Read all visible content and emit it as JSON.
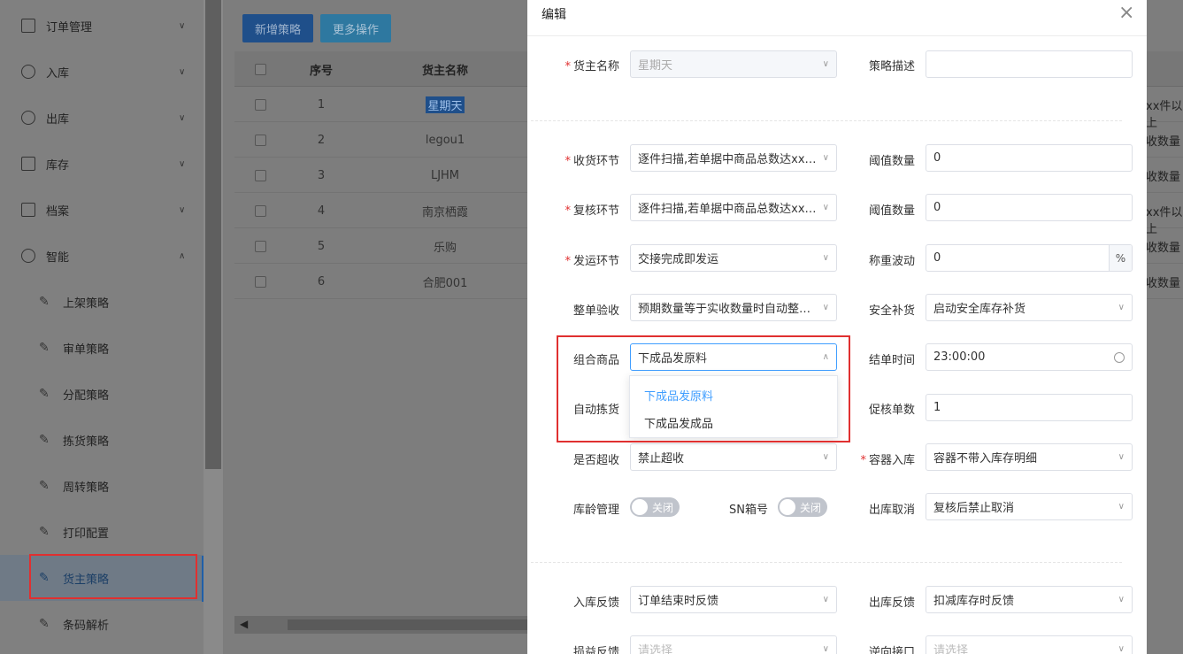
{
  "sidebar": {
    "menus": [
      {
        "label": "订单管理",
        "icon": "order-icon",
        "state": "collapsed"
      },
      {
        "label": "入库",
        "icon": "inbound-icon",
        "state": "collapsed"
      },
      {
        "label": "出库",
        "icon": "outbound-icon",
        "state": "collapsed"
      },
      {
        "label": "库存",
        "icon": "inventory-icon",
        "state": "collapsed"
      },
      {
        "label": "档案",
        "icon": "archive-icon",
        "state": "collapsed"
      },
      {
        "label": "智能",
        "icon": "smart-icon",
        "state": "expanded"
      }
    ],
    "sub_items": [
      "上架策略",
      "审单策略",
      "分配策略",
      "拣货策略",
      "周转策略",
      "打印配置",
      "货主策略",
      "条码解析"
    ],
    "active_sub": "货主策略"
  },
  "toolbar": {
    "add_label": "新增策略",
    "more_label": "更多操作"
  },
  "table": {
    "headers": {
      "index": "序号",
      "owner": "货主名称"
    },
    "rows": [
      {
        "index": "1",
        "owner": "星期天",
        "peek": "xx件以上"
      },
      {
        "index": "2",
        "owner": "legou1",
        "peek": "收数量"
      },
      {
        "index": "3",
        "owner": "LJHM",
        "peek": "收数量"
      },
      {
        "index": "4",
        "owner": "南京栖霞",
        "peek": "xx件以上"
      },
      {
        "index": "5",
        "owner": "乐购",
        "peek": "收数量"
      },
      {
        "index": "6",
        "owner": "合肥001",
        "peek": "收数量"
      }
    ]
  },
  "drawer": {
    "title": "编辑",
    "owner_label": "货主名称",
    "owner_value": "星期天",
    "desc_label": "策略描述",
    "desc_value": "",
    "receive_label": "收货环节",
    "receive_value": "逐件扫描,若单据中商品总数达xxx件以上",
    "threshold1_label": "阈值数量",
    "threshold1_value": "0",
    "review_label": "复核环节",
    "review_value": "逐件扫描,若单据中商品总数达xxx件以上",
    "threshold2_label": "阈值数量",
    "threshold2_value": "0",
    "ship_label": "发运环节",
    "ship_value": "交接完成即发运",
    "weight_label": "称重波动",
    "weight_value": "0",
    "weight_unit": "%",
    "check_label": "整单验收",
    "check_value": "预期数量等于实收数量时自动整单验收",
    "safety_label": "安全补货",
    "safety_value": "启动安全库存补货",
    "combo_label": "组合商品",
    "combo_value": "下成品发原料",
    "close_time_label": "结单时间",
    "close_time_value": "23:00:00",
    "autopick_label": "自动拣货",
    "urge_label": "促核单数",
    "urge_value": "1",
    "over_label": "是否超收",
    "over_value": "禁止超收",
    "container_label": "容器入库",
    "container_value": "容器不带入库存明细",
    "age_label": "库龄管理",
    "age_toggle": "关闭",
    "sn_label": "SN箱号",
    "sn_toggle": "关闭",
    "cancel_label": "出库取消",
    "cancel_value": "复核后禁止取消",
    "in_feedback_label": "入库反馈",
    "in_feedback_value": "订单结束时反馈",
    "out_feedback_label": "出库反馈",
    "out_feedback_value": "扣减库存时反馈",
    "loss_label": "损益反馈",
    "loss_placeholder": "请选择",
    "reverse_label": "逆向接口",
    "reverse_placeholder": "请选择",
    "combo_options": [
      "下成品发原料",
      "下成品发成品"
    ]
  },
  "colors": {
    "accent": "#409eff",
    "required": "#e03030",
    "highlight_box": "#e03030"
  }
}
